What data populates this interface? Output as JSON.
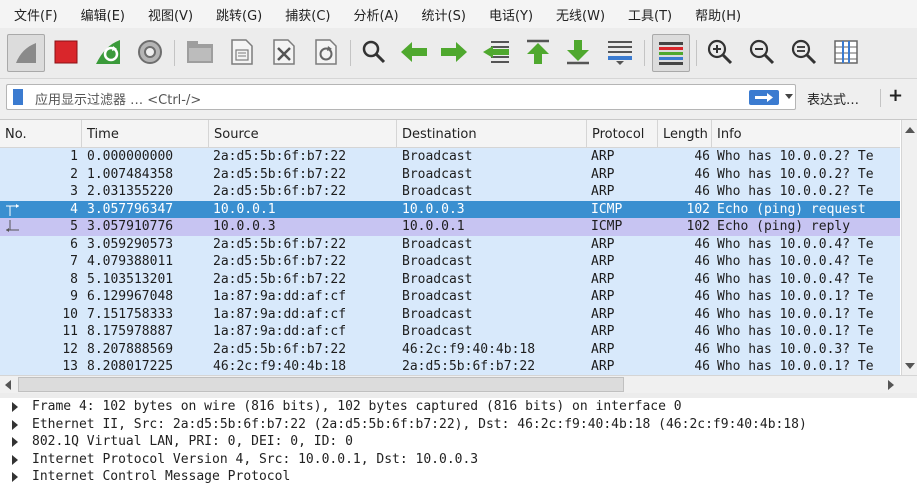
{
  "menu": [
    "文件(F)",
    "编辑(E)",
    "视图(V)",
    "跳转(G)",
    "捕获(C)",
    "分析(A)",
    "统计(S)",
    "电话(Y)",
    "无线(W)",
    "工具(T)",
    "帮助(H)"
  ],
  "toolbar_icons": [
    "shark-fin-icon",
    "stop-icon",
    "restart-capture-icon",
    "capture-options-icon",
    "open-file-icon",
    "save-file-icon",
    "close-file-icon",
    "reload-icon",
    "find-icon",
    "go-back-icon",
    "go-forward-icon",
    "go-to-packet-icon",
    "go-first-icon",
    "go-last-icon",
    "autoscroll-icon",
    "colorize-icon",
    "zoom-in-icon",
    "zoom-out-icon",
    "zoom-normal-icon",
    "resize-columns-icon"
  ],
  "filter": {
    "placeholder": "应用显示过滤器 … <Ctrl-/>",
    "expression_label": "表达式…",
    "add_label": "+"
  },
  "columns": {
    "no": "No.",
    "time": "Time",
    "source": "Source",
    "destination": "Destination",
    "protocol": "Protocol",
    "length": "Length",
    "info": "Info"
  },
  "packets": [
    {
      "no": "1",
      "time": "0.000000000",
      "src": "2a:d5:5b:6f:b7:22",
      "dst": "Broadcast",
      "proto": "ARP",
      "len": "46",
      "info": "Who has 10.0.0.2? Te"
    },
    {
      "no": "2",
      "time": "1.007484358",
      "src": "2a:d5:5b:6f:b7:22",
      "dst": "Broadcast",
      "proto": "ARP",
      "len": "46",
      "info": "Who has 10.0.0.2? Te"
    },
    {
      "no": "3",
      "time": "2.031355220",
      "src": "2a:d5:5b:6f:b7:22",
      "dst": "Broadcast",
      "proto": "ARP",
      "len": "46",
      "info": "Who has 10.0.0.2? Te"
    },
    {
      "no": "4",
      "time": "3.057796347",
      "src": "10.0.0.1",
      "dst": "10.0.0.3",
      "proto": "ICMP",
      "len": "102",
      "info": "Echo (ping) request"
    },
    {
      "no": "5",
      "time": "3.057910776",
      "src": "10.0.0.3",
      "dst": "10.0.0.1",
      "proto": "ICMP",
      "len": "102",
      "info": "Echo (ping) reply"
    },
    {
      "no": "6",
      "time": "3.059290573",
      "src": "2a:d5:5b:6f:b7:22",
      "dst": "Broadcast",
      "proto": "ARP",
      "len": "46",
      "info": "Who has 10.0.0.4? Te"
    },
    {
      "no": "7",
      "time": "4.079388011",
      "src": "2a:d5:5b:6f:b7:22",
      "dst": "Broadcast",
      "proto": "ARP",
      "len": "46",
      "info": "Who has 10.0.0.4? Te"
    },
    {
      "no": "8",
      "time": "5.103513201",
      "src": "2a:d5:5b:6f:b7:22",
      "dst": "Broadcast",
      "proto": "ARP",
      "len": "46",
      "info": "Who has 10.0.0.4? Te"
    },
    {
      "no": "9",
      "time": "6.129967048",
      "src": "1a:87:9a:dd:af:cf",
      "dst": "Broadcast",
      "proto": "ARP",
      "len": "46",
      "info": "Who has 10.0.0.1? Te"
    },
    {
      "no": "10",
      "time": "7.151758333",
      "src": "1a:87:9a:dd:af:cf",
      "dst": "Broadcast",
      "proto": "ARP",
      "len": "46",
      "info": "Who has 10.0.0.1? Te"
    },
    {
      "no": "11",
      "time": "8.175978887",
      "src": "1a:87:9a:dd:af:cf",
      "dst": "Broadcast",
      "proto": "ARP",
      "len": "46",
      "info": "Who has 10.0.0.1? Te"
    },
    {
      "no": "12",
      "time": "8.207888569",
      "src": "2a:d5:5b:6f:b7:22",
      "dst": "46:2c:f9:40:4b:18",
      "proto": "ARP",
      "len": "46",
      "info": "Who has 10.0.0.3? Te"
    },
    {
      "no": "13",
      "time": "8.208017225",
      "src": "46:2c:f9:40:4b:18",
      "dst": "2a:d5:5b:6f:b7:22",
      "proto": "ARP",
      "len": "46",
      "info": "Who has 10.0.0.1? Te"
    }
  ],
  "selected_packet": "4",
  "colors": {
    "arp_row": "#d8e9fb",
    "selected_row": "#3a8fd0",
    "icmp_reply_row": "#c7c4f2",
    "stop_red": "#d9262b",
    "shark_green": "#3a9a3a",
    "accent_blue": "#3b7bd0"
  },
  "details": [
    "Frame 4: 102 bytes on wire (816 bits), 102 bytes captured (816 bits) on interface 0",
    "Ethernet II, Src: 2a:d5:5b:6f:b7:22 (2a:d5:5b:6f:b7:22), Dst: 46:2c:f9:40:4b:18 (46:2c:f9:40:4b:18)",
    "802.1Q Virtual LAN, PRI: 0, DEI: 0, ID: 0",
    "Internet Protocol Version 4, Src: 10.0.0.1, Dst: 10.0.0.3",
    "Internet Control Message Protocol"
  ]
}
